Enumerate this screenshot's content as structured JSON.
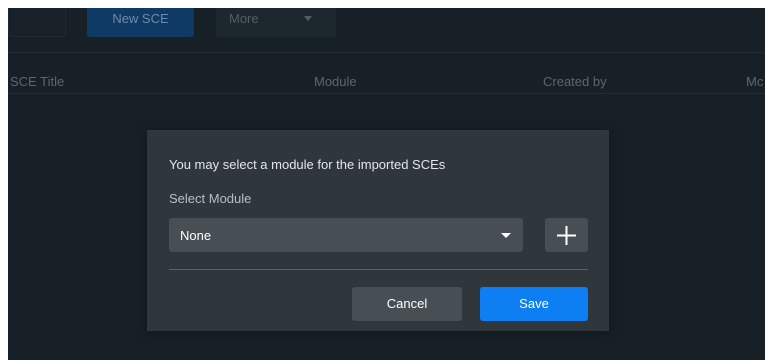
{
  "toolbar": {
    "new_button_label": "New SCE",
    "more_button_label": "More"
  },
  "table": {
    "columns": [
      "SCE Title",
      "Module",
      "Created by",
      "Mc"
    ]
  },
  "dialog": {
    "message": "You may select a module for the imported SCEs",
    "select_label": "Select Module",
    "select_value": "None",
    "add_icon": "plus-icon",
    "cancel_label": "Cancel",
    "save_label": "Save"
  },
  "colors": {
    "background": "#172027",
    "dialog_background": "#2f373c",
    "control_background": "#474f55",
    "primary_button": "#0d7ff2",
    "new_button_dimmed": "#0f3a66"
  }
}
